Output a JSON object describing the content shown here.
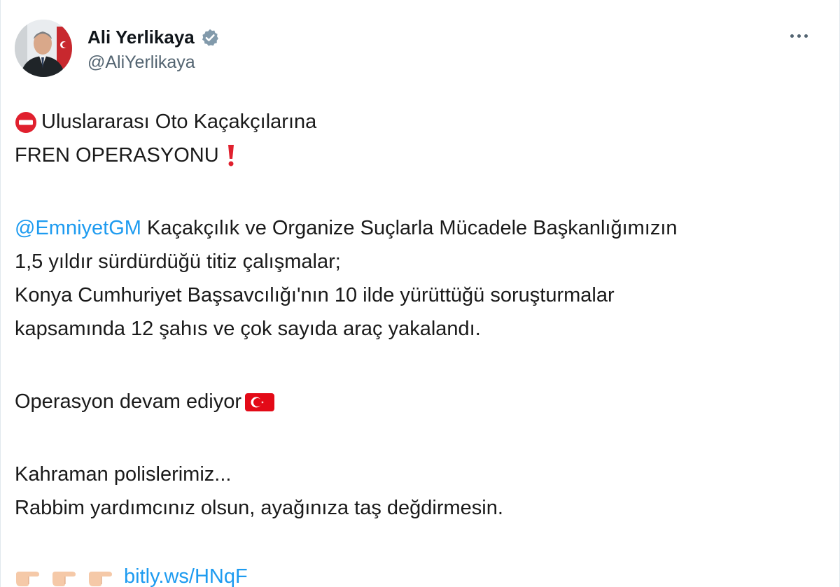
{
  "author": {
    "display_name": "Ali Yerlikaya",
    "handle": "@AliYerlikaya",
    "avatar_icon": "profile-photo",
    "verified_icon": "verified-badge-icon"
  },
  "tweet": {
    "line1": "Uluslararası Oto Kaçakçılarına",
    "line2": "FREN OPERASYONU",
    "mention": "@EmniyetGM",
    "line3_rest": " Kaçakçılık ve Organize Suçlarla Mücadele Başkanlığımızın",
    "line4": "1,5 yıldır sürdürdüğü titiz çalışmalar;",
    "line5": "Konya Cumhuriyet Başsavcılığı'nın 10 ilde yürüttüğü soruşturmalar",
    "line6": "kapsamında 12 şahıs ve çok sayıda araç yakalandı.",
    "line7": "Operasyon devam ediyor",
    "line8": "Kahraman polislerimiz...",
    "line9": "Rabbim yardımcınız olsun, ayağınıza taş değdirmesin.",
    "link": "bitly.ws/HNqF"
  },
  "icons": {
    "no_entry": "no-entry-icon",
    "exclamation": "exclamation-icon",
    "flag": "turkey-flag-icon",
    "pointing_hand": "pointing-hand-icon",
    "more": "more-options-icon"
  },
  "colors": {
    "link": "#1d9bf0",
    "handle": "#536471",
    "verified": "#829aab",
    "red": "#e30a17"
  }
}
